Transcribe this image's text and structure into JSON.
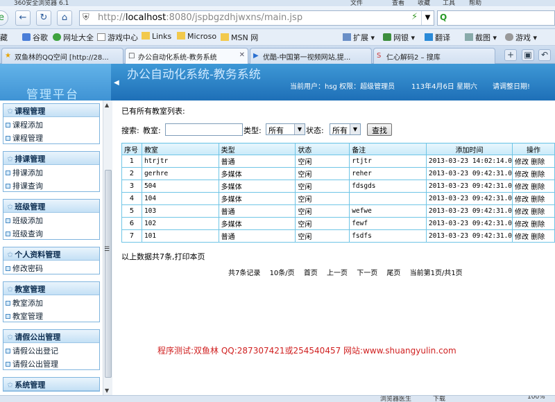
{
  "browser": {
    "window_title": "360安全浏览器 6.1",
    "menu": [
      "文件",
      "查看",
      "收藏",
      "工具",
      "帮助"
    ],
    "url_host": "localhost",
    "url_rest": ":8080/jspbgzdhjwxns/main.jsp",
    "bookmarks": [
      "藏",
      "谷歌",
      "网址大全",
      "游戏中心",
      "Links",
      "Microso",
      "MSN 网"
    ],
    "toolbar_right": [
      "扩展",
      "网银",
      "翻译",
      "截图",
      "游戏"
    ],
    "tabs": [
      {
        "label": "双鱼林的QQ空间 [http://28...",
        "active": false
      },
      {
        "label": "办公自动化系统-教务系统",
        "active": true
      },
      {
        "label": "优酷-中国第一视频网站,提...",
        "active": false
      },
      {
        "label": "仁心解码2 – 搜库",
        "active": false
      }
    ],
    "status_items": [
      "浏览器医生",
      "下载",
      "100%"
    ],
    "colors": {
      "chrome": "#d7e4f2",
      "banner": "#2a80c6"
    }
  },
  "header": {
    "logo": "管理平台",
    "system_title": "办公自动化系统-教务系统",
    "current_user": "当前用户：hsg 权限：超级管理员",
    "date": "113年4月6日 星期六",
    "slogan": "请调整日期!"
  },
  "sidebar": {
    "groups": [
      {
        "title": "课程管理",
        "items": [
          "课程添加",
          "课程管理"
        ]
      },
      {
        "title": "排课管理",
        "items": [
          "排课添加",
          "排课查询"
        ]
      },
      {
        "title": "班级管理",
        "items": [
          "班级添加",
          "班级查询"
        ]
      },
      {
        "title": "个人资料管理",
        "items": [
          "修改密码"
        ]
      },
      {
        "title": "教室管理",
        "items": [
          "教室添加",
          "教室管理"
        ]
      },
      {
        "title": "请假公出管理",
        "items": [
          "请假公出登记",
          "请假公出管理"
        ]
      },
      {
        "title": "系统管理",
        "items": []
      }
    ]
  },
  "main": {
    "caption": "已有所有教室列表:",
    "search": {
      "prefix": "搜索:",
      "room_label": "教室:",
      "room_value": "",
      "type_label": "类型:",
      "type_value": "所有",
      "status_label": "状态:",
      "status_value": "所有",
      "button": "查找"
    },
    "table": {
      "columns": [
        "序号",
        "教室",
        "类型",
        "状态",
        "备注",
        "添加时间",
        "操作"
      ],
      "rows": [
        {
          "no": "1",
          "room": "htrjtr",
          "type": "普通",
          "status": "空闲",
          "note": "rtjtr",
          "time": "2013-03-23 14:02:14.0"
        },
        {
          "no": "2",
          "room": "gerhre",
          "type": "多媒体",
          "status": "空闲",
          "note": "reher",
          "time": "2013-03-23 09:42:31.0"
        },
        {
          "no": "3",
          "room": "504",
          "type": "多媒体",
          "status": "空闲",
          "note": "fdsgds",
          "time": "2013-03-23 09:42:31.0"
        },
        {
          "no": "4",
          "room": "104",
          "type": "多媒体",
          "status": "空闲",
          "note": "",
          "time": "2013-03-23 09:42:31.0"
        },
        {
          "no": "5",
          "room": "103",
          "type": "普通",
          "status": "空闲",
          "note": "wefwe",
          "time": "2013-03-23 09:42:31.0"
        },
        {
          "no": "6",
          "room": "102",
          "type": "多媒体",
          "status": "空闲",
          "note": "fewf",
          "time": "2013-03-23 09:42:31.0"
        },
        {
          "no": "7",
          "room": "101",
          "type": "普通",
          "status": "空闲",
          "note": "fsdfs",
          "time": "2013-03-23 09:42:31.0"
        }
      ],
      "edit_label": "修改",
      "delete_label": "删除"
    },
    "summary": "以上数据共7条,打印本页",
    "pager": {
      "total": "共7条记录",
      "per_page": "10条/页",
      "first": "首页",
      "prev": "上一页",
      "next": "下一页",
      "last": "尾页",
      "current": "当前第1页/共1页"
    },
    "footer_note": "程序测试:双鱼林 QQ:287307421或254540457 网站:www.shuangyulin.com"
  }
}
